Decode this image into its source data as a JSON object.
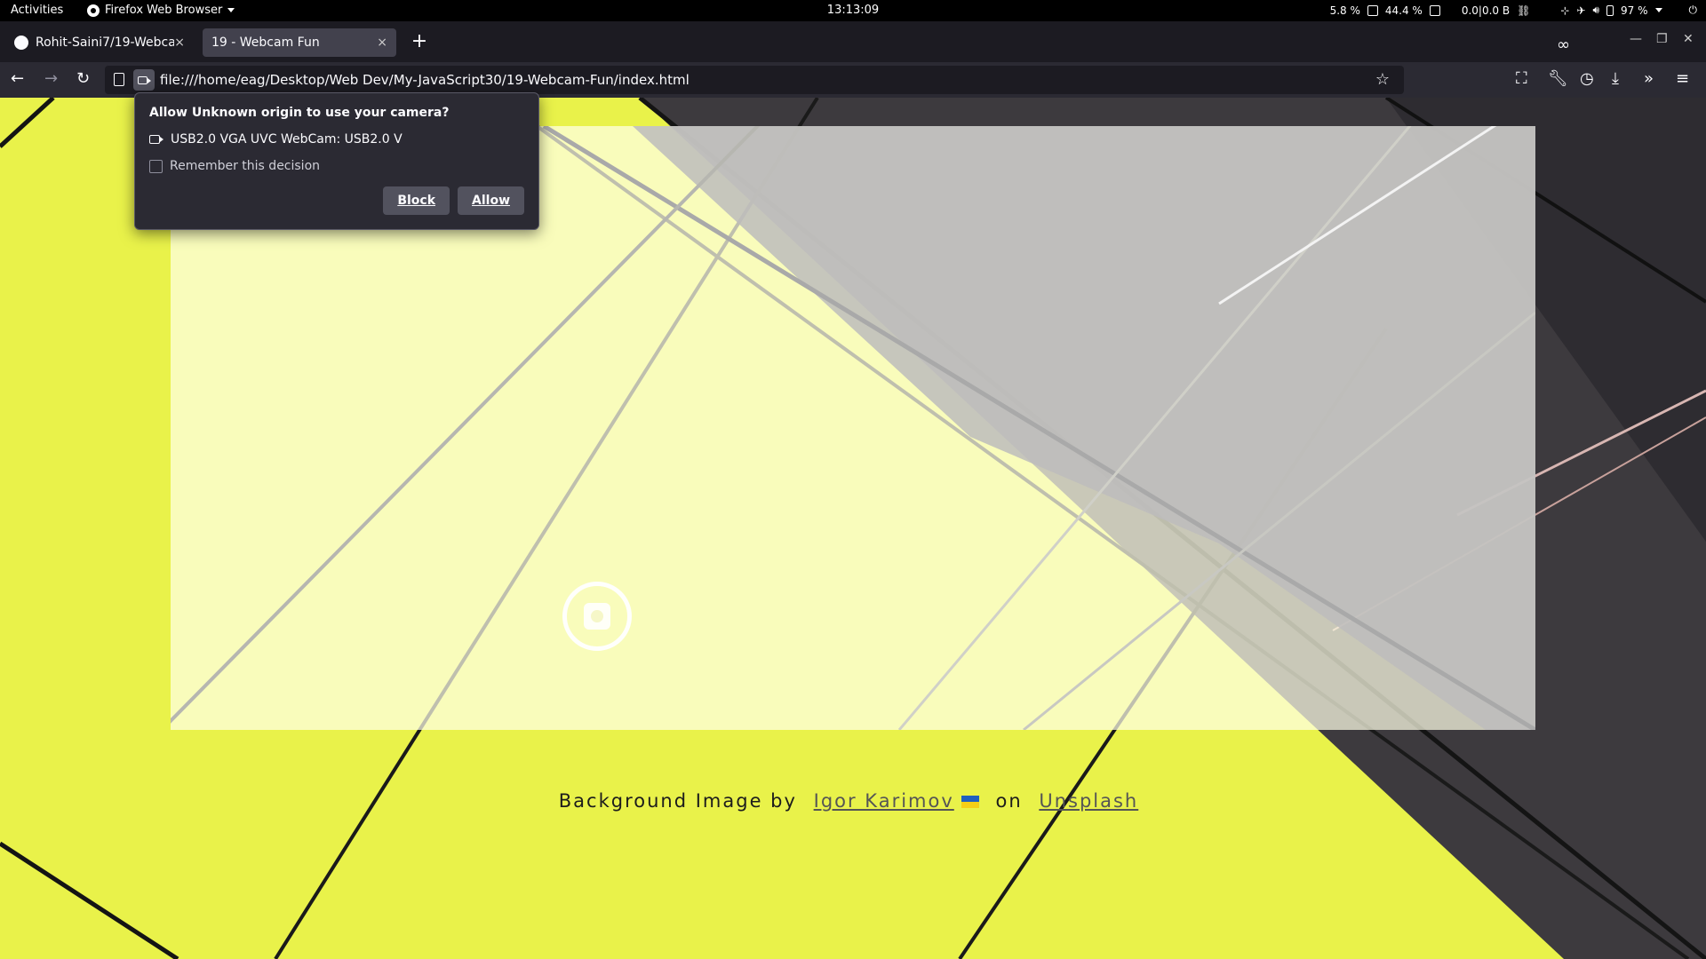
{
  "topbar": {
    "activities": "Activities",
    "app_name": "Firefox Web Browser",
    "clock": "13:13:09",
    "cpu": "5.8 %",
    "mem": "44.4 %",
    "net": "0.0|0.0 B",
    "battery": "97 %"
  },
  "tabs": [
    {
      "label": "Rohit-Saini7/19-Webcam",
      "close": "×"
    },
    {
      "label": "19 - Webcam Fun",
      "close": "×"
    }
  ],
  "new_tab": "+",
  "url": "file:///home/eag/Desktop/Web Dev/My-JavaScript30/19-Webcam-Fun/index.html",
  "permission": {
    "question": "Allow Unknown origin to use your camera?",
    "device": "USB2.0 VGA UVC WebCam: USB2.0 V",
    "remember": "Remember this decision",
    "block": "Block",
    "allow": "Allow"
  },
  "credit": {
    "prefix": "Background Image by",
    "author": "Igor Karimov",
    "middle": "on",
    "site": "Unsplash"
  },
  "colors": {
    "accent_yellow": "#e9f24a",
    "browser_dark": "#1c1b22",
    "toolbar": "#2b2a33"
  }
}
